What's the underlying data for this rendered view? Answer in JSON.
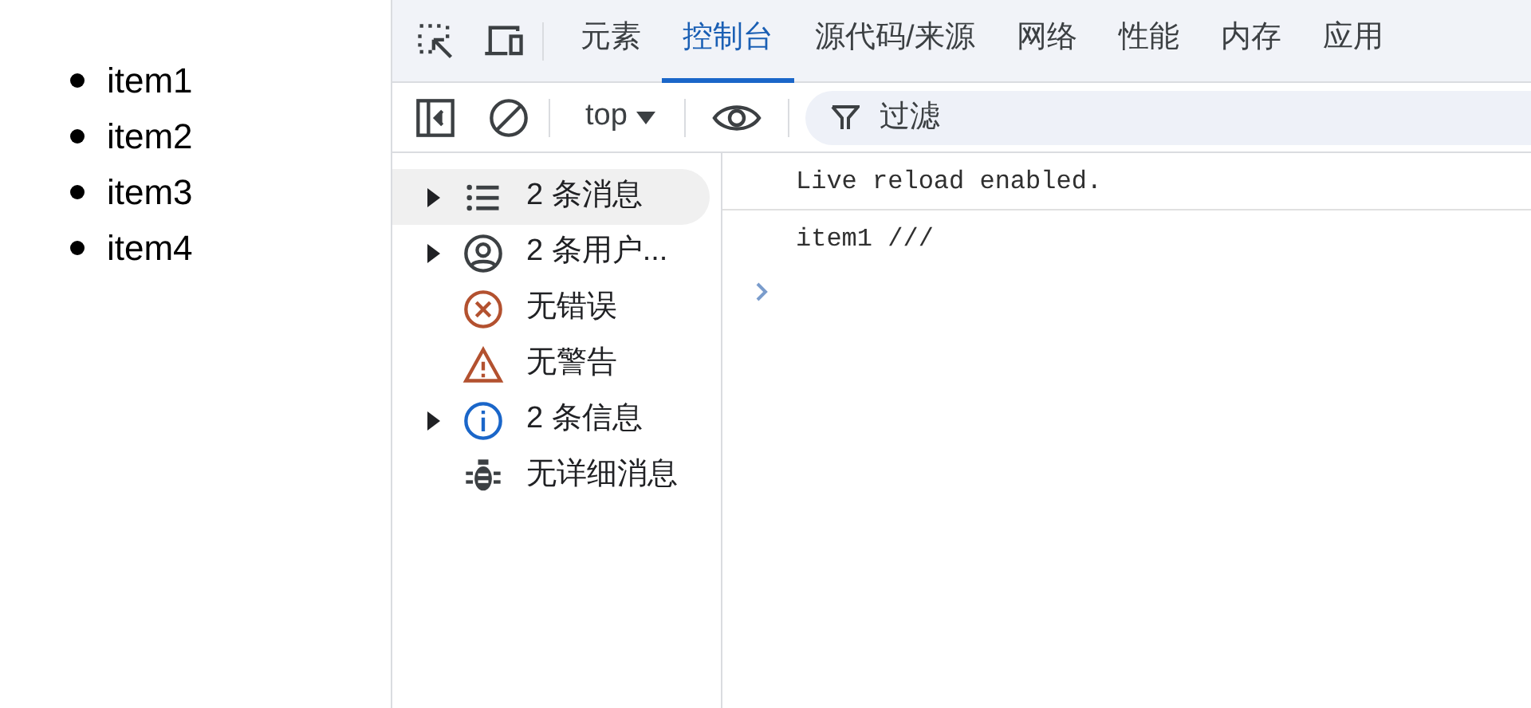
{
  "page": {
    "items": [
      "item1",
      "item2",
      "item3",
      "item4"
    ]
  },
  "devtools": {
    "tabs": [
      {
        "label": "元素",
        "selected": false
      },
      {
        "label": "控制台",
        "selected": true
      },
      {
        "label": "源代码/来源",
        "selected": false
      },
      {
        "label": "网络",
        "selected": false
      },
      {
        "label": "性能",
        "selected": false
      },
      {
        "label": "内存",
        "selected": false
      },
      {
        "label": "应用",
        "selected": false
      }
    ],
    "toolbar": {
      "context": "top",
      "filter_placeholder": "过滤"
    },
    "sidebar": [
      {
        "kind": "messages",
        "label": "2 条消息",
        "expandable": true,
        "selected": true
      },
      {
        "kind": "user",
        "label": "2 条用户...",
        "expandable": true,
        "selected": false
      },
      {
        "kind": "error",
        "label": "无错误",
        "expandable": false,
        "selected": false
      },
      {
        "kind": "warning",
        "label": "无警告",
        "expandable": false,
        "selected": false
      },
      {
        "kind": "info",
        "label": "2 条信息",
        "expandable": true,
        "selected": false
      },
      {
        "kind": "verbose",
        "label": "无详细消息",
        "expandable": false,
        "selected": false
      }
    ],
    "console": {
      "messages": [
        "Live reload enabled.",
        "item1 ///"
      ]
    }
  }
}
